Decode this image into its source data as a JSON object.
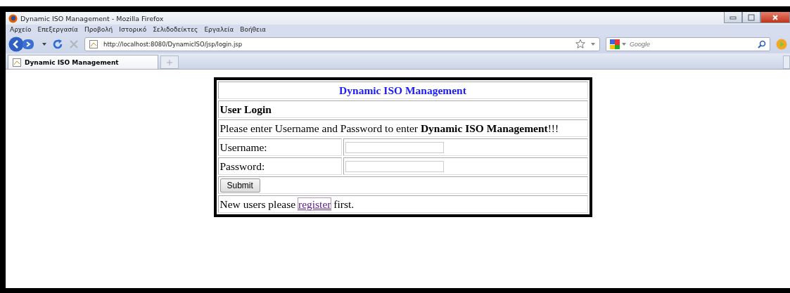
{
  "window": {
    "title": "Dynamic ISO Management - Mozilla Firefox"
  },
  "menu": [
    "Αρχείο",
    "Επεξεργασία",
    "Προβολή",
    "Ιστορικό",
    "Σελιδοδείκτες",
    "Εργαλεία",
    "Βοήθεια"
  ],
  "address_bar": {
    "value": "http://localhost:8080/DynamicISO/jsp/login.jsp"
  },
  "search": {
    "placeholder": "Google"
  },
  "tabs": [
    {
      "label": "Dynamic ISO Management",
      "selected": true
    }
  ],
  "login": {
    "title": "Dynamic ISO Management",
    "heading": "User Login",
    "intro": "Please enter Username and Password to enter **Dynamic ISO Management**!!!",
    "fields": [
      {
        "label": "Username:"
      },
      {
        "label": "Password:"
      }
    ],
    "submit": "Submit",
    "footer": {
      "before": "New users please",
      "link": "register",
      "after": "first."
    }
  }
}
